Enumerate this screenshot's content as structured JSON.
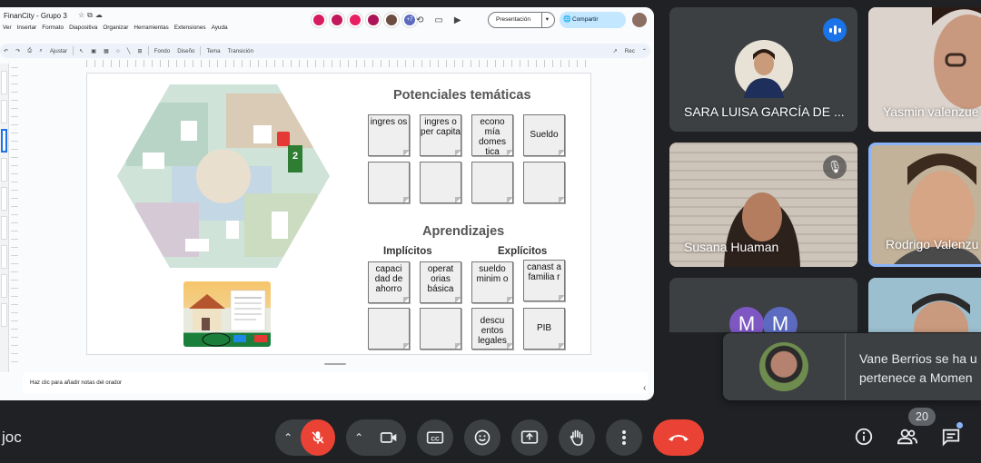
{
  "slides": {
    "doc_title": "FinanCity - Grupo 3",
    "menu": [
      "Ver",
      "Insertar",
      "Formato",
      "Diapositiva",
      "Organizar",
      "Herramientas",
      "Extensiones",
      "Ayuda"
    ],
    "collaborator_count": "+7",
    "present_label": "Presentación",
    "share_label": "Compartir",
    "zoom_label": "Ajustar",
    "toolbar_items": [
      "Fondo",
      "Diseño",
      "Tema",
      "Transición"
    ],
    "rec_label": "Rec",
    "speaker_notes_placeholder": "Haz clic para añadir notas del orador",
    "board_badge_number": "2"
  },
  "slide": {
    "title_topics": "Potenciales temáticas",
    "topics_row1": [
      "ingres os",
      "ingres o per capita",
      "econo mía domes tica",
      "Sueldo"
    ],
    "title_learning": "Aprendizajes",
    "label_implicit": "Implícitos",
    "label_explicit": "Explícitos",
    "learning_row1": [
      "capaci dad de ahorro",
      "operat orias básica",
      "sueldo minim o",
      "canast a familia r"
    ],
    "learning_row2": [
      "",
      "",
      "descu entos legales",
      "PIB"
    ]
  },
  "participants": [
    {
      "name": "SARA LUISA GARCÍA DE ...",
      "state": "speaking"
    },
    {
      "name": "Yasmin valenzue"
    },
    {
      "name": "Susana Huaman",
      "state": "muted"
    },
    {
      "name": "Rodrigo Valenzu"
    },
    {
      "initials": [
        "M",
        "M"
      ]
    },
    {
      "name": ""
    }
  ],
  "toast": {
    "line1": "Vane Berrios se ha u",
    "line2": "pertenece a Momen"
  },
  "controls": {
    "meeting_code": "joc",
    "participant_count": "20"
  },
  "colors": {
    "end_call": "#ea4335",
    "mic_off": "#ea4335",
    "speaking_badge": "#1a73e8",
    "share_button": "#c2e7ff",
    "tile_background": "#3c4043"
  },
  "icons": [
    "mic-off-icon",
    "camera-icon",
    "captions-icon",
    "emoji-icon",
    "present-icon",
    "hand-icon",
    "more-icon",
    "end-call-icon",
    "info-icon",
    "people-icon",
    "chat-icon"
  ]
}
